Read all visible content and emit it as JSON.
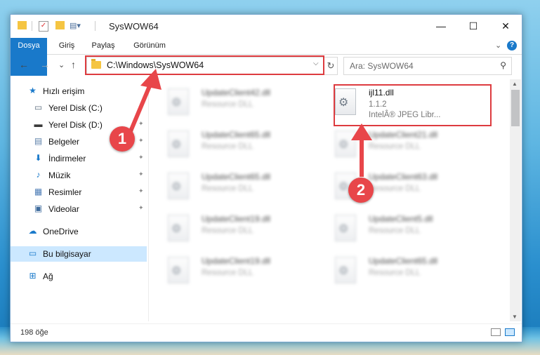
{
  "window": {
    "title": "SysWOW64",
    "controls": {
      "minimize": "—",
      "maximize": "☐",
      "close": "✕"
    }
  },
  "ribbon": {
    "tabs": [
      "Dosya",
      "Giriş",
      "Paylaş",
      "Görünüm"
    ],
    "expand_icon": "chevron-down-icon",
    "help_icon": "?"
  },
  "address_bar": {
    "path": "C:\\Windows\\SysWOW64",
    "dropdown_icon": "⌵",
    "refresh_icon": "↻"
  },
  "search": {
    "placeholder": "Ara: SysWOW64",
    "icon": "⚲"
  },
  "navigation": {
    "back_icon": "←",
    "forward_icon": "→",
    "recent_icon": "⌄",
    "up_icon": "↑"
  },
  "sidebar": {
    "items": [
      {
        "label": "Hızlı erişim",
        "icon": "★",
        "icon_color": "#1979ca",
        "pinned": false
      },
      {
        "label": "Yerel Disk (C:)",
        "icon": "▭",
        "icon_color": "#5a6c7d",
        "pinned": true
      },
      {
        "label": "Yerel Disk (D:)",
        "icon": "▬",
        "icon_color": "#3a3a3a",
        "pinned": true
      },
      {
        "label": "Belgeler",
        "icon": "▤",
        "icon_color": "#5b7fa8",
        "pinned": true
      },
      {
        "label": "İndirmeler",
        "icon": "⬇",
        "icon_color": "#1979ca",
        "pinned": true
      },
      {
        "label": "Müzik",
        "icon": "♪",
        "icon_color": "#1979ca",
        "pinned": true
      },
      {
        "label": "Resimler",
        "icon": "▦",
        "icon_color": "#4b7bb5",
        "pinned": true
      },
      {
        "label": "Videolar",
        "icon": "▣",
        "icon_color": "#3e6b9c",
        "pinned": true
      },
      {
        "label": "OneDrive",
        "icon": "☁",
        "icon_color": "#1979ca",
        "pinned": false
      },
      {
        "label": "Bu bilgisayar",
        "icon": "▭",
        "icon_color": "#1979ca",
        "pinned": false,
        "selected": true
      },
      {
        "label": "Ağ",
        "icon": "⊞",
        "icon_color": "#1979ca",
        "pinned": false
      }
    ],
    "pin_icon": "📌"
  },
  "files": {
    "highlighted": {
      "name": "ijl11.dll",
      "version": "1.1.2",
      "description": "IntelÂ® JPEG Libr..."
    },
    "blurred": [
      {
        "name": "UpdateClient42.dll",
        "type": "Resource DLL"
      },
      {
        "name": "UpdateClient65.dll",
        "type": "Resource DLL"
      },
      {
        "name": "UpdateClient21.dll",
        "type": "Resource DLL"
      },
      {
        "name": "UpdateClient65.dll",
        "type": "Resource DLL"
      },
      {
        "name": "UpdateClient63.dll",
        "type": "Resource DLL"
      },
      {
        "name": "UpdateClient19.dll",
        "type": "Resource DLL"
      },
      {
        "name": "UpdateClient5.dll",
        "type": "Resource DLL"
      },
      {
        "name": "UpdateClient19.dll",
        "type": "Resource DLL"
      },
      {
        "name": "UpdateClient65.dll",
        "type": "Resource DLL"
      }
    ]
  },
  "status": {
    "item_count": "198 öğe"
  },
  "annotations": {
    "step1": "1",
    "step2": "2",
    "color": "#e8464a"
  }
}
